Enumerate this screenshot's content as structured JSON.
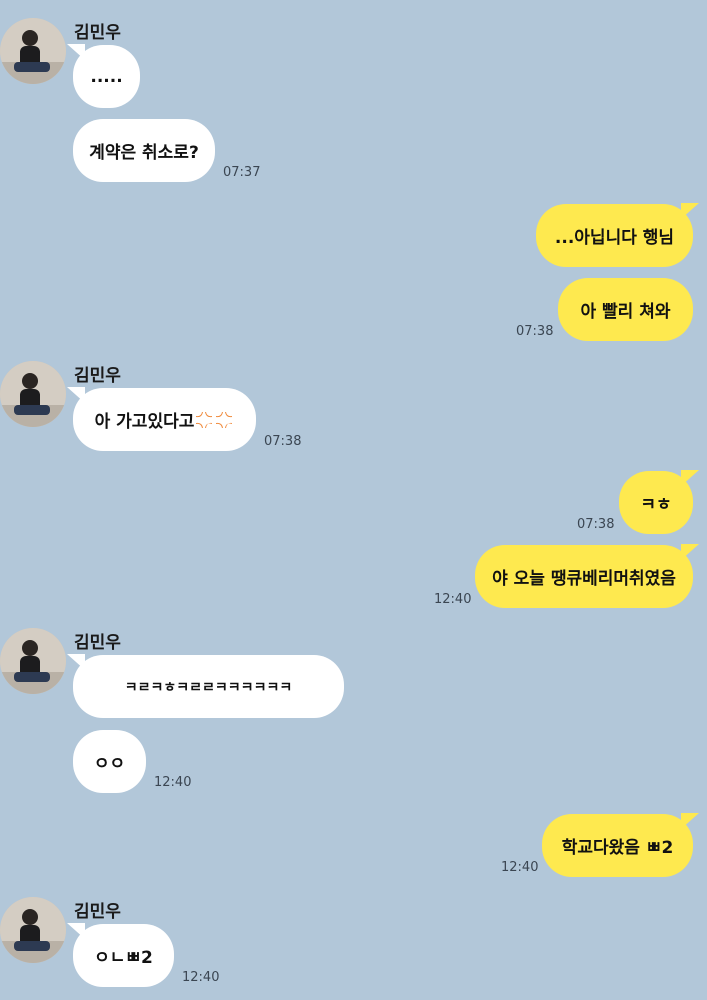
{
  "contact": {
    "name": "김민우"
  },
  "messages": {
    "m1": {
      "text": "....."
    },
    "m2": {
      "text": "계약은 취소로?",
      "time": "07:37"
    },
    "m3": {
      "text": "...아닙니다 행님"
    },
    "m4": {
      "text": "아 빨리 쳐와",
      "time": "07:38"
    },
    "m5": {
      "text": "아 가고있다고",
      "emoji": "anger-symbol-icon",
      "time": "07:38"
    },
    "m6": {
      "text": "ㅋㅎ",
      "time": "07:38"
    },
    "m7": {
      "text": "야 오늘 땡큐베리머취였음",
      "time": "12:40"
    },
    "m8": {
      "text": "ㅋㄹㅋㅎㅋㄹㄹㅋㅋㅋㅋㅋㅋ"
    },
    "m9": {
      "text": "ㅇㅇ",
      "time": "12:40"
    },
    "m10": {
      "text": "학교다왔음 ㅃ2",
      "time": "12:40"
    },
    "m11": {
      "text": "ㅇㄴㅃ2",
      "time": "12:40"
    }
  },
  "colors": {
    "background": "#b2c7d9",
    "incoming_bubble": "#ffffff",
    "outgoing_bubble": "#fee94f",
    "emoji": "#f08a3c"
  }
}
